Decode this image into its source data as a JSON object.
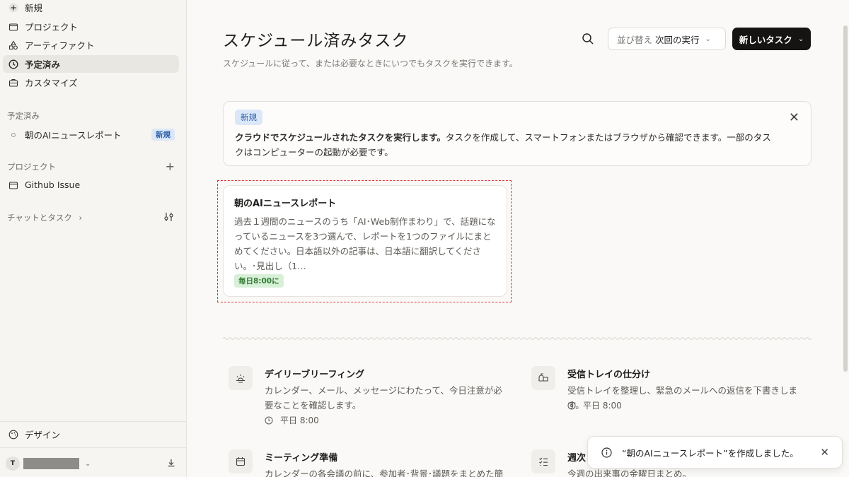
{
  "sidebar": {
    "nav": [
      {
        "label": "新規",
        "icon": "plus-icon"
      },
      {
        "label": "プロジェクト",
        "icon": "folder-icon"
      },
      {
        "label": "アーティファクト",
        "icon": "artifacts-icon"
      },
      {
        "label": "予定済み",
        "icon": "clock-icon",
        "active": true
      },
      {
        "label": "カスタマイズ",
        "icon": "briefcase-icon"
      }
    ],
    "scheduled_section": "予定済み",
    "scheduled_item": {
      "label": "朝のAIニュースレポート",
      "badge": "新規"
    },
    "projects_section": "プロジェクト",
    "project_item": "Github Issue",
    "chats_section": "チャットとタスク",
    "design_label": "デザイン",
    "user_initial": "T"
  },
  "main": {
    "title": "スケジュール済みタスク",
    "subtitle": "スケジュールに従って、または必要なときにいつでもタスクを実行できます。",
    "sort": {
      "prefix": "並び替え",
      "value": "次回の実行"
    },
    "new_task_label": "新しいタスク",
    "banner": {
      "tag": "新規",
      "bold": "クラウドでスケジュールされたタスクを実行します。",
      "text": "タスクを作成して、スマートフォンまたはブラウザから確認できます。一部のタスクはコンピューターの起動が必要です。"
    },
    "task_card": {
      "title": "朝のAIニュースレポート",
      "description": "過去１週間のニュースのうち「AI･Web制作まわり」で、話題になっているニュースを3つ選んで、レポートを1つのファイルにまとめてください。日本語以外の記事は、日本語に翻訳してください。･見出し（1…",
      "schedule": "毎日8:00に"
    },
    "templates": [
      {
        "title": "デイリーブリーフィング",
        "description": "カレンダー、メール、メッセージにわたって、今日注意が必要なことを確認します。",
        "time": "平日 8:00",
        "icon": "sunrise-icon"
      },
      {
        "title": "受信トレイの仕分け",
        "description": "受信トレイを整理し、緊急のメールへの返信を下書きします。",
        "time": "平日 8:00",
        "icon": "mailbox-icon"
      },
      {
        "title": "ミーティング準備",
        "description": "カレンダーの各会議の前に、参加者･背景･議題をまとめた簡",
        "icon": "calendar-icon"
      },
      {
        "title": "週次",
        "description": "今週の出来事の金曜日まとめ。",
        "icon": "checklist-icon"
      }
    ]
  },
  "toast": {
    "text": "“朝のAIニュースレポート”を作成しました。"
  }
}
